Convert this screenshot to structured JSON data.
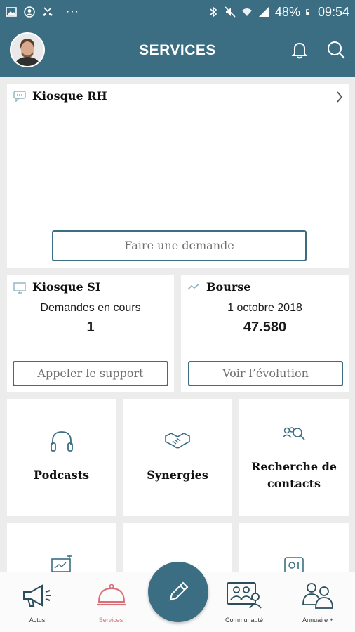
{
  "status_bar": {
    "battery": "48%",
    "time": "09:54",
    "more": "···"
  },
  "header": {
    "title": "SERVICES"
  },
  "kiosque_rh": {
    "title": "Kiosque RH",
    "button": "Faire une demande"
  },
  "kiosque_si": {
    "title": "Kiosque SI",
    "subtitle": "Demandes en cours",
    "count": "1",
    "button": "Appeler le support"
  },
  "bourse": {
    "title": "Bourse",
    "date": "1 octobre 2018",
    "value": "47.580",
    "button": "Voir l’évolution"
  },
  "tiles": {
    "podcasts": "Podcasts",
    "synergies": "Synergies",
    "recherche_line1": "Recherche de",
    "recherche_line2": "contacts"
  },
  "bottom_nav": {
    "actus": "Actus",
    "services": "Services",
    "communaute": "Communauté",
    "annuaire": "Annuaire +"
  },
  "colors": {
    "brand": "#3b6e82",
    "active_nav": "#d8707a"
  },
  "icons": [
    "image-icon",
    "account-circle-icon",
    "missed-call-icon",
    "bluetooth-icon",
    "mute-icon",
    "wifi-icon",
    "signal-icon",
    "bell-icon",
    "search-icon",
    "chat-icon",
    "desktop-icon",
    "trend-icon",
    "chevron-right-icon",
    "headphones-icon",
    "handshake-icon",
    "people-search-icon",
    "megaphone-icon",
    "cloche-icon",
    "pencil-icon",
    "community-icon",
    "directory-icon"
  ]
}
